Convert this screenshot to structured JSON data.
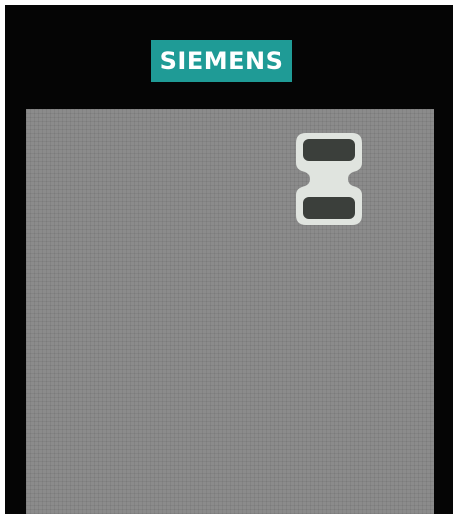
{
  "brand": {
    "name": "SIEMENS",
    "color": "#1f9b96",
    "text_color": "#ffffff"
  },
  "device": {
    "bezel_color": "#050505"
  },
  "screen": {
    "background_color": "#8b8b8b",
    "scroll_indicator": {
      "icon": "scroll-arrows-icon",
      "frame_color": "#e0e4df",
      "key_color": "#3b3f3b"
    }
  }
}
